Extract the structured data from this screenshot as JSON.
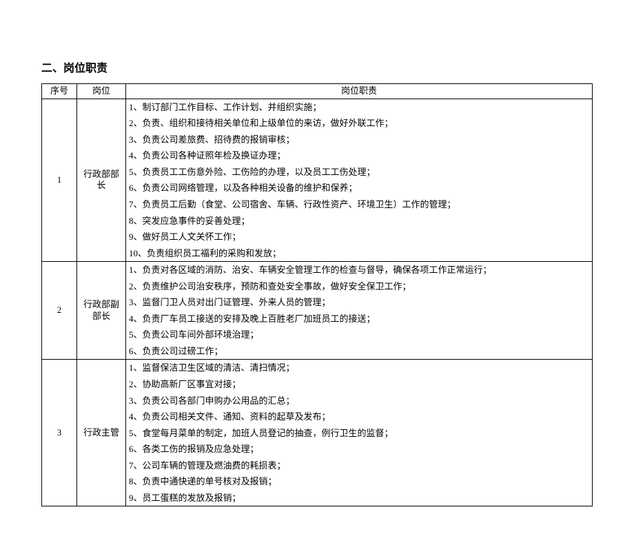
{
  "section_title": "二、岗位职责",
  "headers": {
    "num": "序号",
    "position": "岗位",
    "duties": "岗位职责"
  },
  "rows": [
    {
      "num": "1",
      "position": "行政部部长",
      "duties": [
        "1、制订部门工作目标、工作计划、并组织实施；",
        "2、负责、组织和接待相关单位和上级单位的来访，做好外联工作；",
        "3、负责公司差旅费、招待费的报销审核；",
        "4、负责公司各种证照年检及换证办理；",
        "5、负责员工工伤意外险、工伤险的办理，以及员工工伤处理；",
        "6、负责公司网络管理，以及各种相关设备的维护和保养；",
        "7、负责员工后勤（食堂、公司宿舍、车辆、行政性资产、环境卫生）工作的管理；",
        "8、突发应急事件的妥善处理；",
        "9、做好员工人文关怀工作；",
        "10、负责组织员工福利的采购和发放；"
      ]
    },
    {
      "num": "2",
      "position": "行政部副部长",
      "duties": [
        "1、负责对各区域的消防、治安、车辆安全管理工作的检查与督导，确保各项工作正常运行；",
        "2、负责维护公司治安秩序，预防和查处安全事故，做好安全保卫工作；",
        "3、监督门卫人员对出门证管理、外来人员的管理；",
        "4、负责厂车员工接送的安排及晚上百胜老厂加班员工的接送；",
        "5、负责公司车间外部环境治理；",
        "6、负责公司过磅工作；"
      ]
    },
    {
      "num": "3",
      "position": "行政主管",
      "duties": [
        "1、监督保洁卫生区域的清洁、清扫情况；",
        "2、协助高新厂区事宜对接；",
        "3、负责公司各部门申购办公用品的汇总；",
        "4、负责公司相关文件、通知、资料的起草及发布；",
        "5、食堂每月菜单的制定，加班人员登记的抽查，例行卫生的监督；",
        "6、各类工伤的报销及应急处理；",
        "7、公司车辆的管理及燃油费的耗损表；",
        "8、负责中通快递的单号核对及报销；",
        "9、员工蛋糕的发放及报销；"
      ]
    }
  ]
}
